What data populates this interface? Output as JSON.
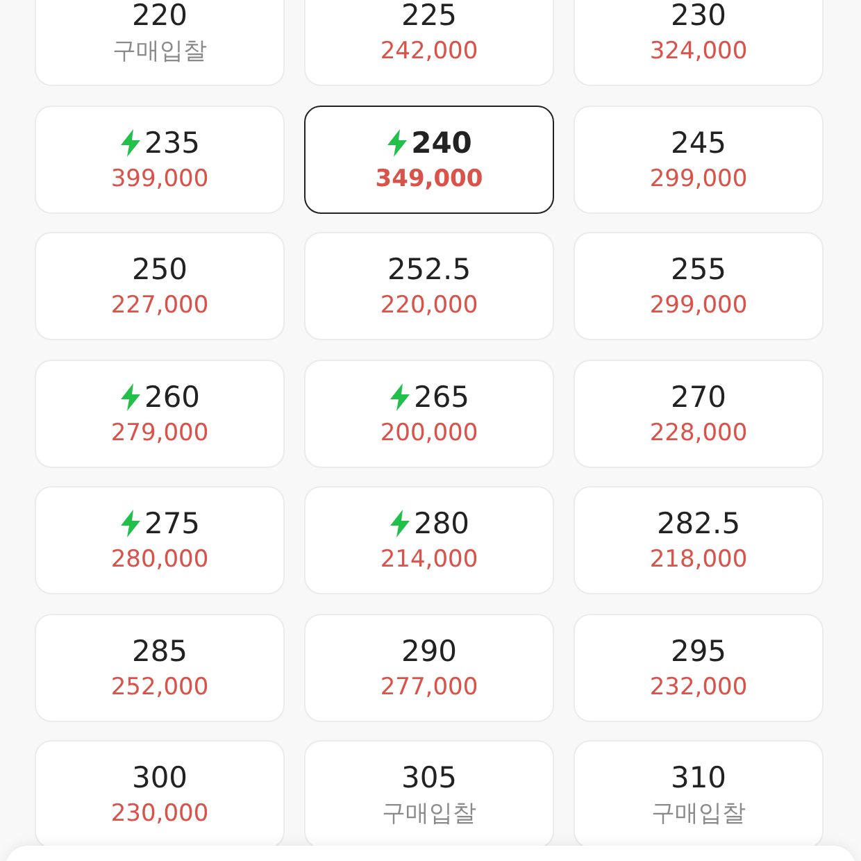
{
  "sizes": [
    {
      "size": "220",
      "fast": false,
      "selected": false,
      "kind": "bid",
      "price": "구매입찰"
    },
    {
      "size": "225",
      "fast": false,
      "selected": false,
      "kind": "price",
      "price": "242,000"
    },
    {
      "size": "230",
      "fast": false,
      "selected": false,
      "kind": "price",
      "price": "324,000"
    },
    {
      "size": "235",
      "fast": true,
      "selected": false,
      "kind": "price",
      "price": "399,000"
    },
    {
      "size": "240",
      "fast": true,
      "selected": true,
      "kind": "price",
      "price": "349,000"
    },
    {
      "size": "245",
      "fast": false,
      "selected": false,
      "kind": "price",
      "price": "299,000"
    },
    {
      "size": "250",
      "fast": false,
      "selected": false,
      "kind": "price",
      "price": "227,000"
    },
    {
      "size": "252.5",
      "fast": false,
      "selected": false,
      "kind": "price",
      "price": "220,000"
    },
    {
      "size": "255",
      "fast": false,
      "selected": false,
      "kind": "price",
      "price": "299,000"
    },
    {
      "size": "260",
      "fast": true,
      "selected": false,
      "kind": "price",
      "price": "279,000"
    },
    {
      "size": "265",
      "fast": true,
      "selected": false,
      "kind": "price",
      "price": "200,000"
    },
    {
      "size": "270",
      "fast": false,
      "selected": false,
      "kind": "price",
      "price": "228,000"
    },
    {
      "size": "275",
      "fast": true,
      "selected": false,
      "kind": "price",
      "price": "280,000"
    },
    {
      "size": "280",
      "fast": true,
      "selected": false,
      "kind": "price",
      "price": "214,000"
    },
    {
      "size": "282.5",
      "fast": false,
      "selected": false,
      "kind": "price",
      "price": "218,000"
    },
    {
      "size": "285",
      "fast": false,
      "selected": false,
      "kind": "price",
      "price": "252,000"
    },
    {
      "size": "290",
      "fast": false,
      "selected": false,
      "kind": "price",
      "price": "277,000"
    },
    {
      "size": "295",
      "fast": false,
      "selected": false,
      "kind": "price",
      "price": "232,000"
    },
    {
      "size": "300",
      "fast": false,
      "selected": false,
      "kind": "price",
      "price": "230,000"
    },
    {
      "size": "305",
      "fast": false,
      "selected": false,
      "kind": "bid",
      "price": "구매입찰"
    },
    {
      "size": "310",
      "fast": false,
      "selected": false,
      "kind": "bid",
      "price": "구매입찰"
    }
  ]
}
